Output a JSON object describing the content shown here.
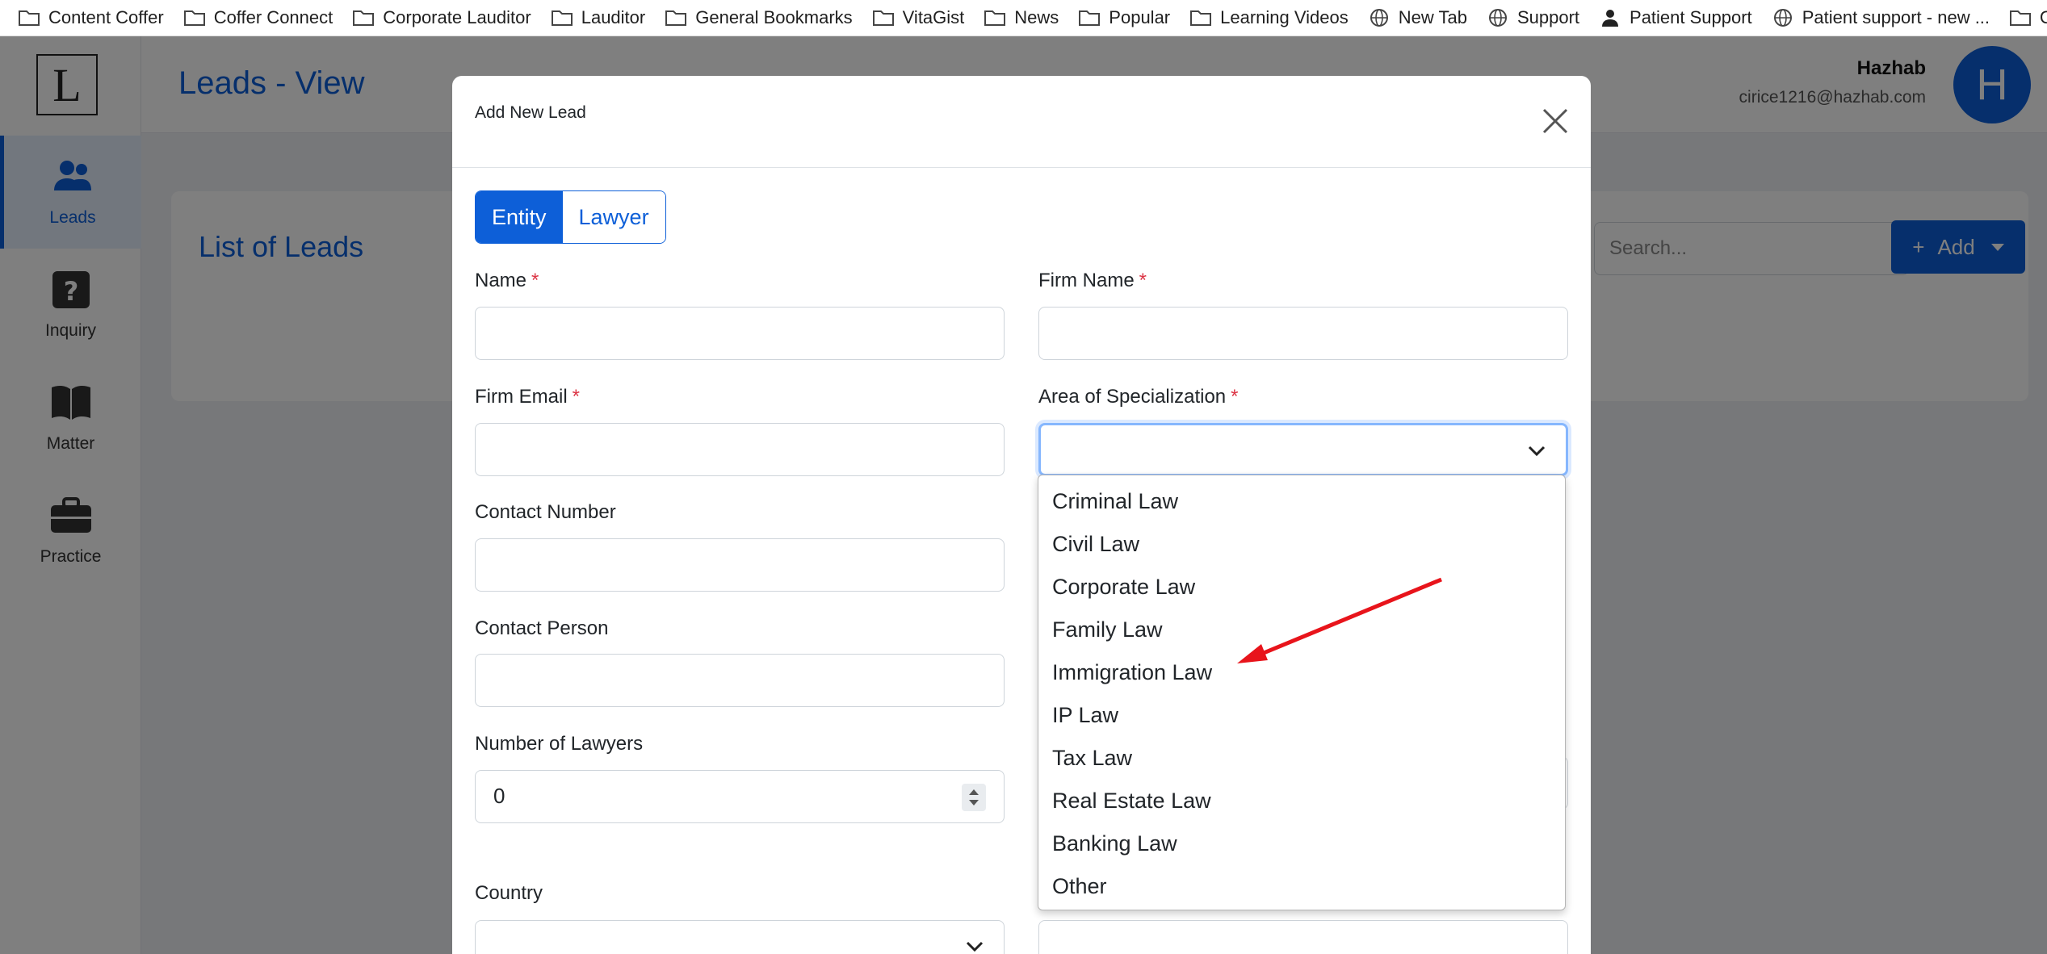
{
  "bookmarks": [
    {
      "label": "Content Coffer",
      "icon": "folder-icon"
    },
    {
      "label": "Coffer Connect",
      "icon": "folder-icon"
    },
    {
      "label": "Corporate Lauditor",
      "icon": "folder-icon"
    },
    {
      "label": "Lauditor",
      "icon": "folder-icon"
    },
    {
      "label": "General Bookmarks",
      "icon": "folder-icon"
    },
    {
      "label": "VitaGist",
      "icon": "folder-icon"
    },
    {
      "label": "News",
      "icon": "folder-icon"
    },
    {
      "label": "Popular",
      "icon": "folder-icon"
    },
    {
      "label": "Learning Videos",
      "icon": "folder-icon"
    },
    {
      "label": "New Tab",
      "icon": "globe-icon"
    },
    {
      "label": "Support",
      "icon": "globe-icon"
    },
    {
      "label": "Patient Support",
      "icon": "person-icon"
    },
    {
      "label": "Patient support - new ...",
      "icon": "globe-icon"
    },
    {
      "label": "Other Bookmarks",
      "icon": "folder-icon"
    }
  ],
  "logo": {
    "letter": "L"
  },
  "sidebar": {
    "items": [
      {
        "label": "Leads",
        "icon": "users-icon"
      },
      {
        "label": "Inquiry",
        "icon": "question-icon"
      },
      {
        "label": "Matter",
        "icon": "book-icon"
      },
      {
        "label": "Practice",
        "icon": "briefcase-icon"
      }
    ]
  },
  "header": {
    "title": "Leads - View",
    "user_name": "Hazhab",
    "user_email": "cirice1216@hazhab.com",
    "avatar_letter": "H"
  },
  "main": {
    "card_title": "List of Leads",
    "search_placeholder": "Search...",
    "add_label": "Add",
    "add_plus": "+"
  },
  "modal": {
    "title": "Add New Lead",
    "tabs": [
      "Entity",
      "Lawyer"
    ],
    "required_mark": "*",
    "fields": {
      "name": "Name",
      "firm_name": "Firm Name",
      "firm_email": "Firm Email",
      "area": "Area of Specialization",
      "contact_number": "Contact Number",
      "contact_person": "Contact Person",
      "num_lawyers": "Number of Lawyers",
      "num_lawyers_value": "0",
      "country": "Country"
    },
    "area_options": [
      "Criminal Law",
      "Civil Law",
      "Corporate Law",
      "Family Law",
      "Immigration Law",
      "IP Law",
      "Tax Law",
      "Real Estate Law",
      "Banking Law",
      "Other"
    ]
  },
  "colors": {
    "accent": "#0d5fd8",
    "required": "#dc3545",
    "annotation_arrow": "#e8141b"
  }
}
